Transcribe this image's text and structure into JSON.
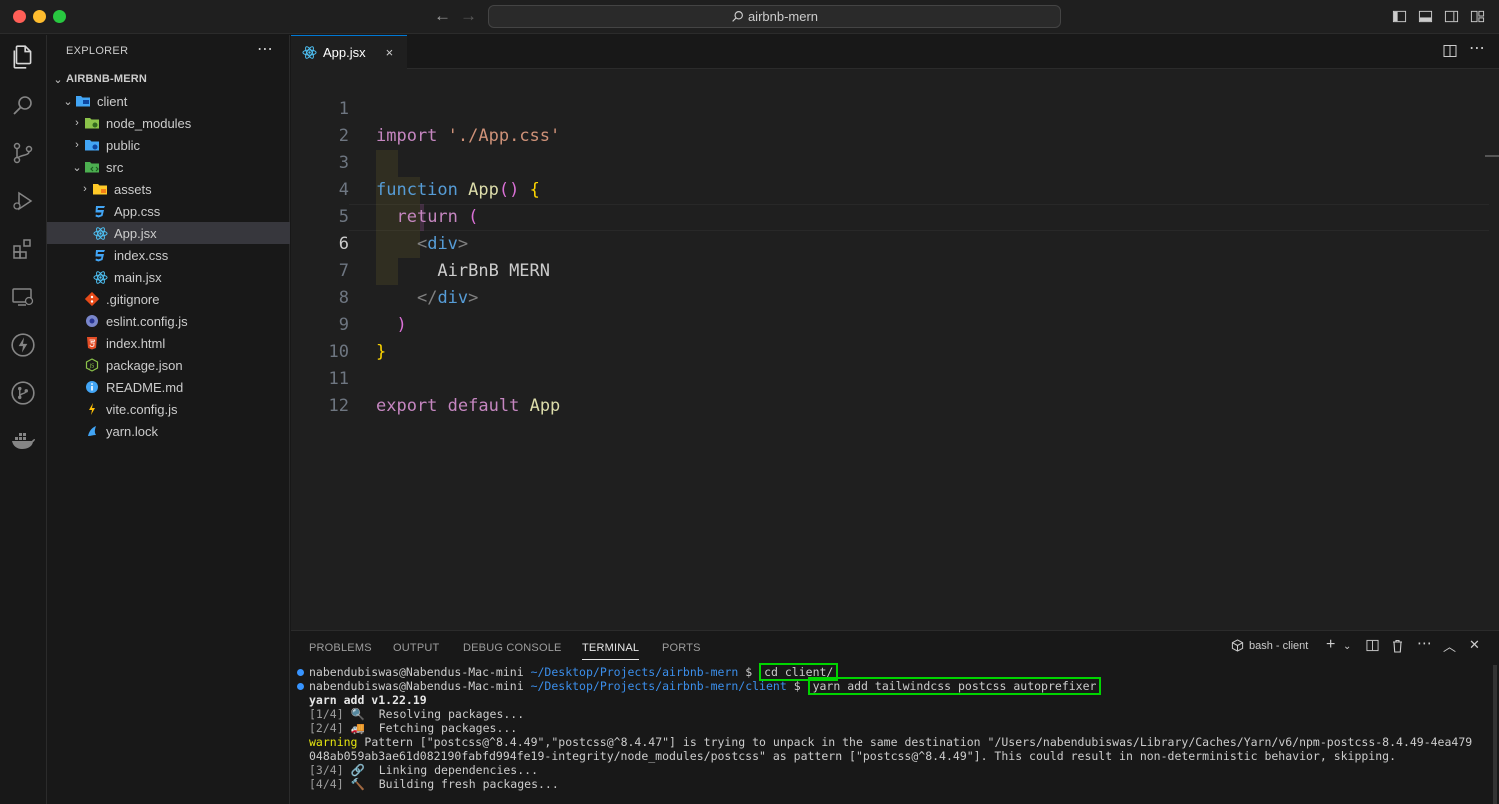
{
  "window": {
    "command_center": "airbnb-mern"
  },
  "sidebar": {
    "header": "EXPLORER",
    "root": "AIRBNB-MERN",
    "tree": [
      {
        "label": "client",
        "depth": 1,
        "type": "folder-open",
        "icon": "client-folder-icon"
      },
      {
        "label": "node_modules",
        "depth": 2,
        "type": "folder-closed",
        "icon": "node-folder-icon"
      },
      {
        "label": "public",
        "depth": 2,
        "type": "folder-closed",
        "icon": "public-folder-icon"
      },
      {
        "label": "src",
        "depth": 2,
        "type": "folder-open",
        "icon": "src-folder-icon"
      },
      {
        "label": "assets",
        "depth": 3,
        "type": "folder-closed",
        "icon": "assets-folder-icon"
      },
      {
        "label": "App.css",
        "depth": 3,
        "type": "file",
        "icon": "css-file-icon"
      },
      {
        "label": "App.jsx",
        "depth": 3,
        "type": "file",
        "icon": "react-file-icon",
        "selected": true
      },
      {
        "label": "index.css",
        "depth": 3,
        "type": "file",
        "icon": "css-file-icon"
      },
      {
        "label": "main.jsx",
        "depth": 3,
        "type": "file",
        "icon": "react-file-icon"
      },
      {
        "label": ".gitignore",
        "depth": 2,
        "type": "file",
        "icon": "git-file-icon"
      },
      {
        "label": "eslint.config.js",
        "depth": 2,
        "type": "file",
        "icon": "eslint-file-icon"
      },
      {
        "label": "index.html",
        "depth": 2,
        "type": "file",
        "icon": "html-file-icon"
      },
      {
        "label": "package.json",
        "depth": 2,
        "type": "file",
        "icon": "node-file-icon"
      },
      {
        "label": "README.md",
        "depth": 2,
        "type": "file",
        "icon": "info-file-icon"
      },
      {
        "label": "vite.config.js",
        "depth": 2,
        "type": "file",
        "icon": "vite-file-icon"
      },
      {
        "label": "yarn.lock",
        "depth": 2,
        "type": "file",
        "icon": "yarn-file-icon"
      }
    ]
  },
  "editor": {
    "tab_label": "App.jsx",
    "close_glyph": "×",
    "line_numbers": [
      "1",
      "2",
      "3",
      "4",
      "5",
      "6",
      "7",
      "8",
      "9",
      "10",
      "11",
      "12"
    ],
    "code": {
      "l1_kw": "import",
      "l1_str": "'./App.css'",
      "l3_kw": "function",
      "l3_fn": "App",
      "l3_paren": "()",
      "l3_brace": "{",
      "l4_kw": "return",
      "l4_paren": "(",
      "l5_open": "<",
      "l5_tag": "div",
      "l5_close": ">",
      "l6_text": "AirBnB MERN",
      "l7_open": "</",
      "l7_tag": "div",
      "l7_close": ">",
      "l8_paren": ")",
      "l9_brace": "}",
      "l11_kw1": "export",
      "l11_kw2": "default",
      "l11_fn": "App"
    }
  },
  "panel": {
    "tabs": [
      "PROBLEMS",
      "OUTPUT",
      "DEBUG CONSOLE",
      "TERMINAL",
      "PORTS"
    ],
    "active_tab": "TERMINAL",
    "terminal_name": "bash - client",
    "terminal": {
      "l1_user": "nabendubiswas@Nabendus-Mac-mini",
      "l1_path": "~/Desktop/Projects/airbnb-mern",
      "l1_prompt": "$",
      "l1_cmd": "cd client/",
      "l2_user": "nabendubiswas@Nabendus-Mac-mini",
      "l2_path": "~/Desktop/Projects/airbnb-mern/client",
      "l2_prompt": "$",
      "l2_cmd": "yarn add tailwindcss postcss autoprefixer",
      "l3": "yarn add v1.22.19",
      "l4_step": "[1/4]",
      "l4_emoji": "🔍",
      "l4_text": "Resolving packages...",
      "l5_step": "[2/4]",
      "l5_emoji": "🚚",
      "l5_text": "Fetching packages...",
      "l6_warn": "warning",
      "l6_text": "Pattern [\"postcss@^8.4.49\",\"postcss@^8.4.47\"] is trying to unpack in the same destination \"/Users/nabendubiswas/Library/Caches/Yarn/v6/npm-postcss-8.4.49-4ea479",
      "l7_text": "048ab059ab3ae61d082190fabfd994fe19-integrity/node_modules/postcss\" as pattern [\"postcss@^8.4.49\"]. This could result in non-deterministic behavior, skipping.",
      "l8_step": "[3/4]",
      "l8_emoji": "🔗",
      "l8_text": "Linking dependencies...",
      "l9_step": "[4/4]",
      "l9_emoji": "🔨",
      "l9_text": "Building fresh packages..."
    }
  },
  "colors": {
    "accent": "#0078d4",
    "highlight_box": "#00d400",
    "keyword": "#c586c0",
    "string": "#ce9178",
    "function": "#dcdcaa"
  }
}
